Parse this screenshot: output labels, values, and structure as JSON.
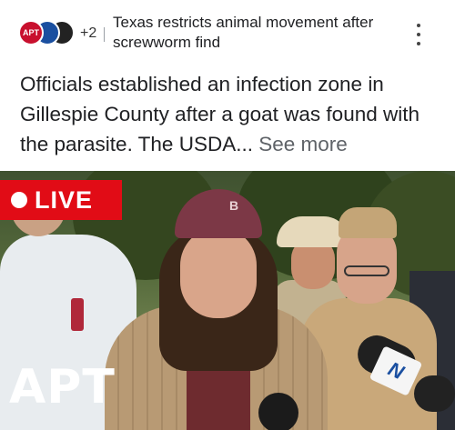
{
  "header": {
    "source_avatars": [
      "APT",
      "",
      ""
    ],
    "extra_sources_count": "+2",
    "title": "Texas restricts animal movement after screwworm find",
    "menu_icon": "more-vert-icon"
  },
  "summary": {
    "text": "Officials established an infection zone in Gillespie County after a goat was found with the parasite. The USDA...",
    "see_more_label": "See more"
  },
  "video": {
    "live_label": "LIVE",
    "watermark": "APT",
    "cap_logo": "B",
    "live_color": "#e10c16"
  }
}
